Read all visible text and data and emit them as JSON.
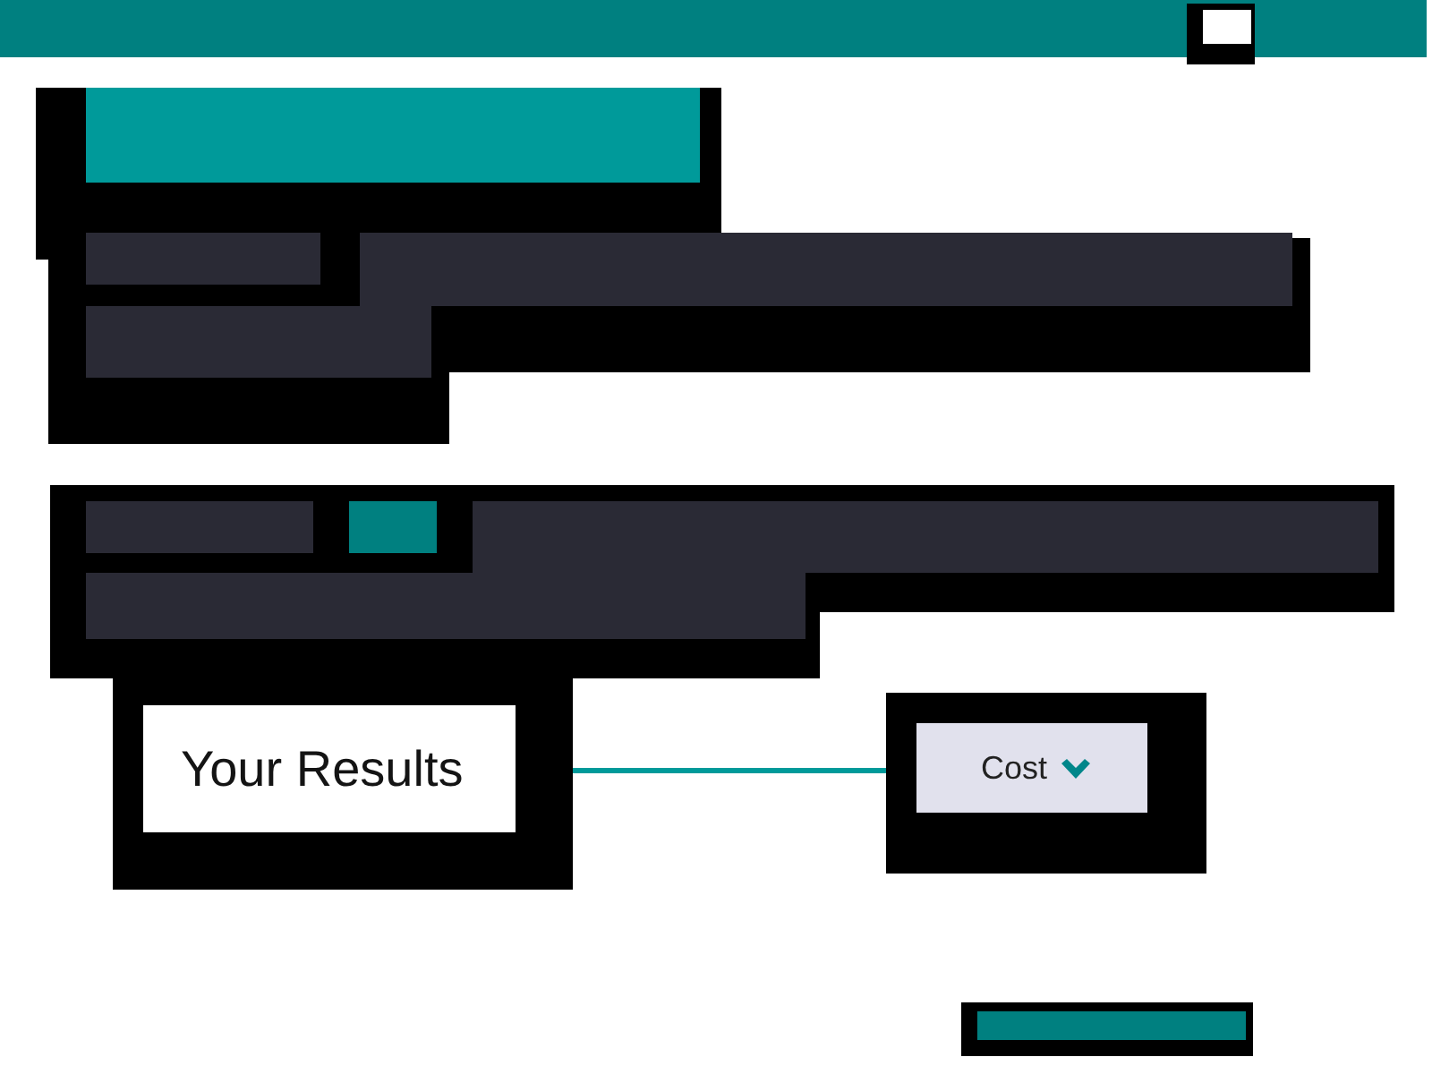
{
  "results": {
    "heading": "Your Results"
  },
  "sort_dropdown": {
    "label": "Cost",
    "expanded": false
  }
}
